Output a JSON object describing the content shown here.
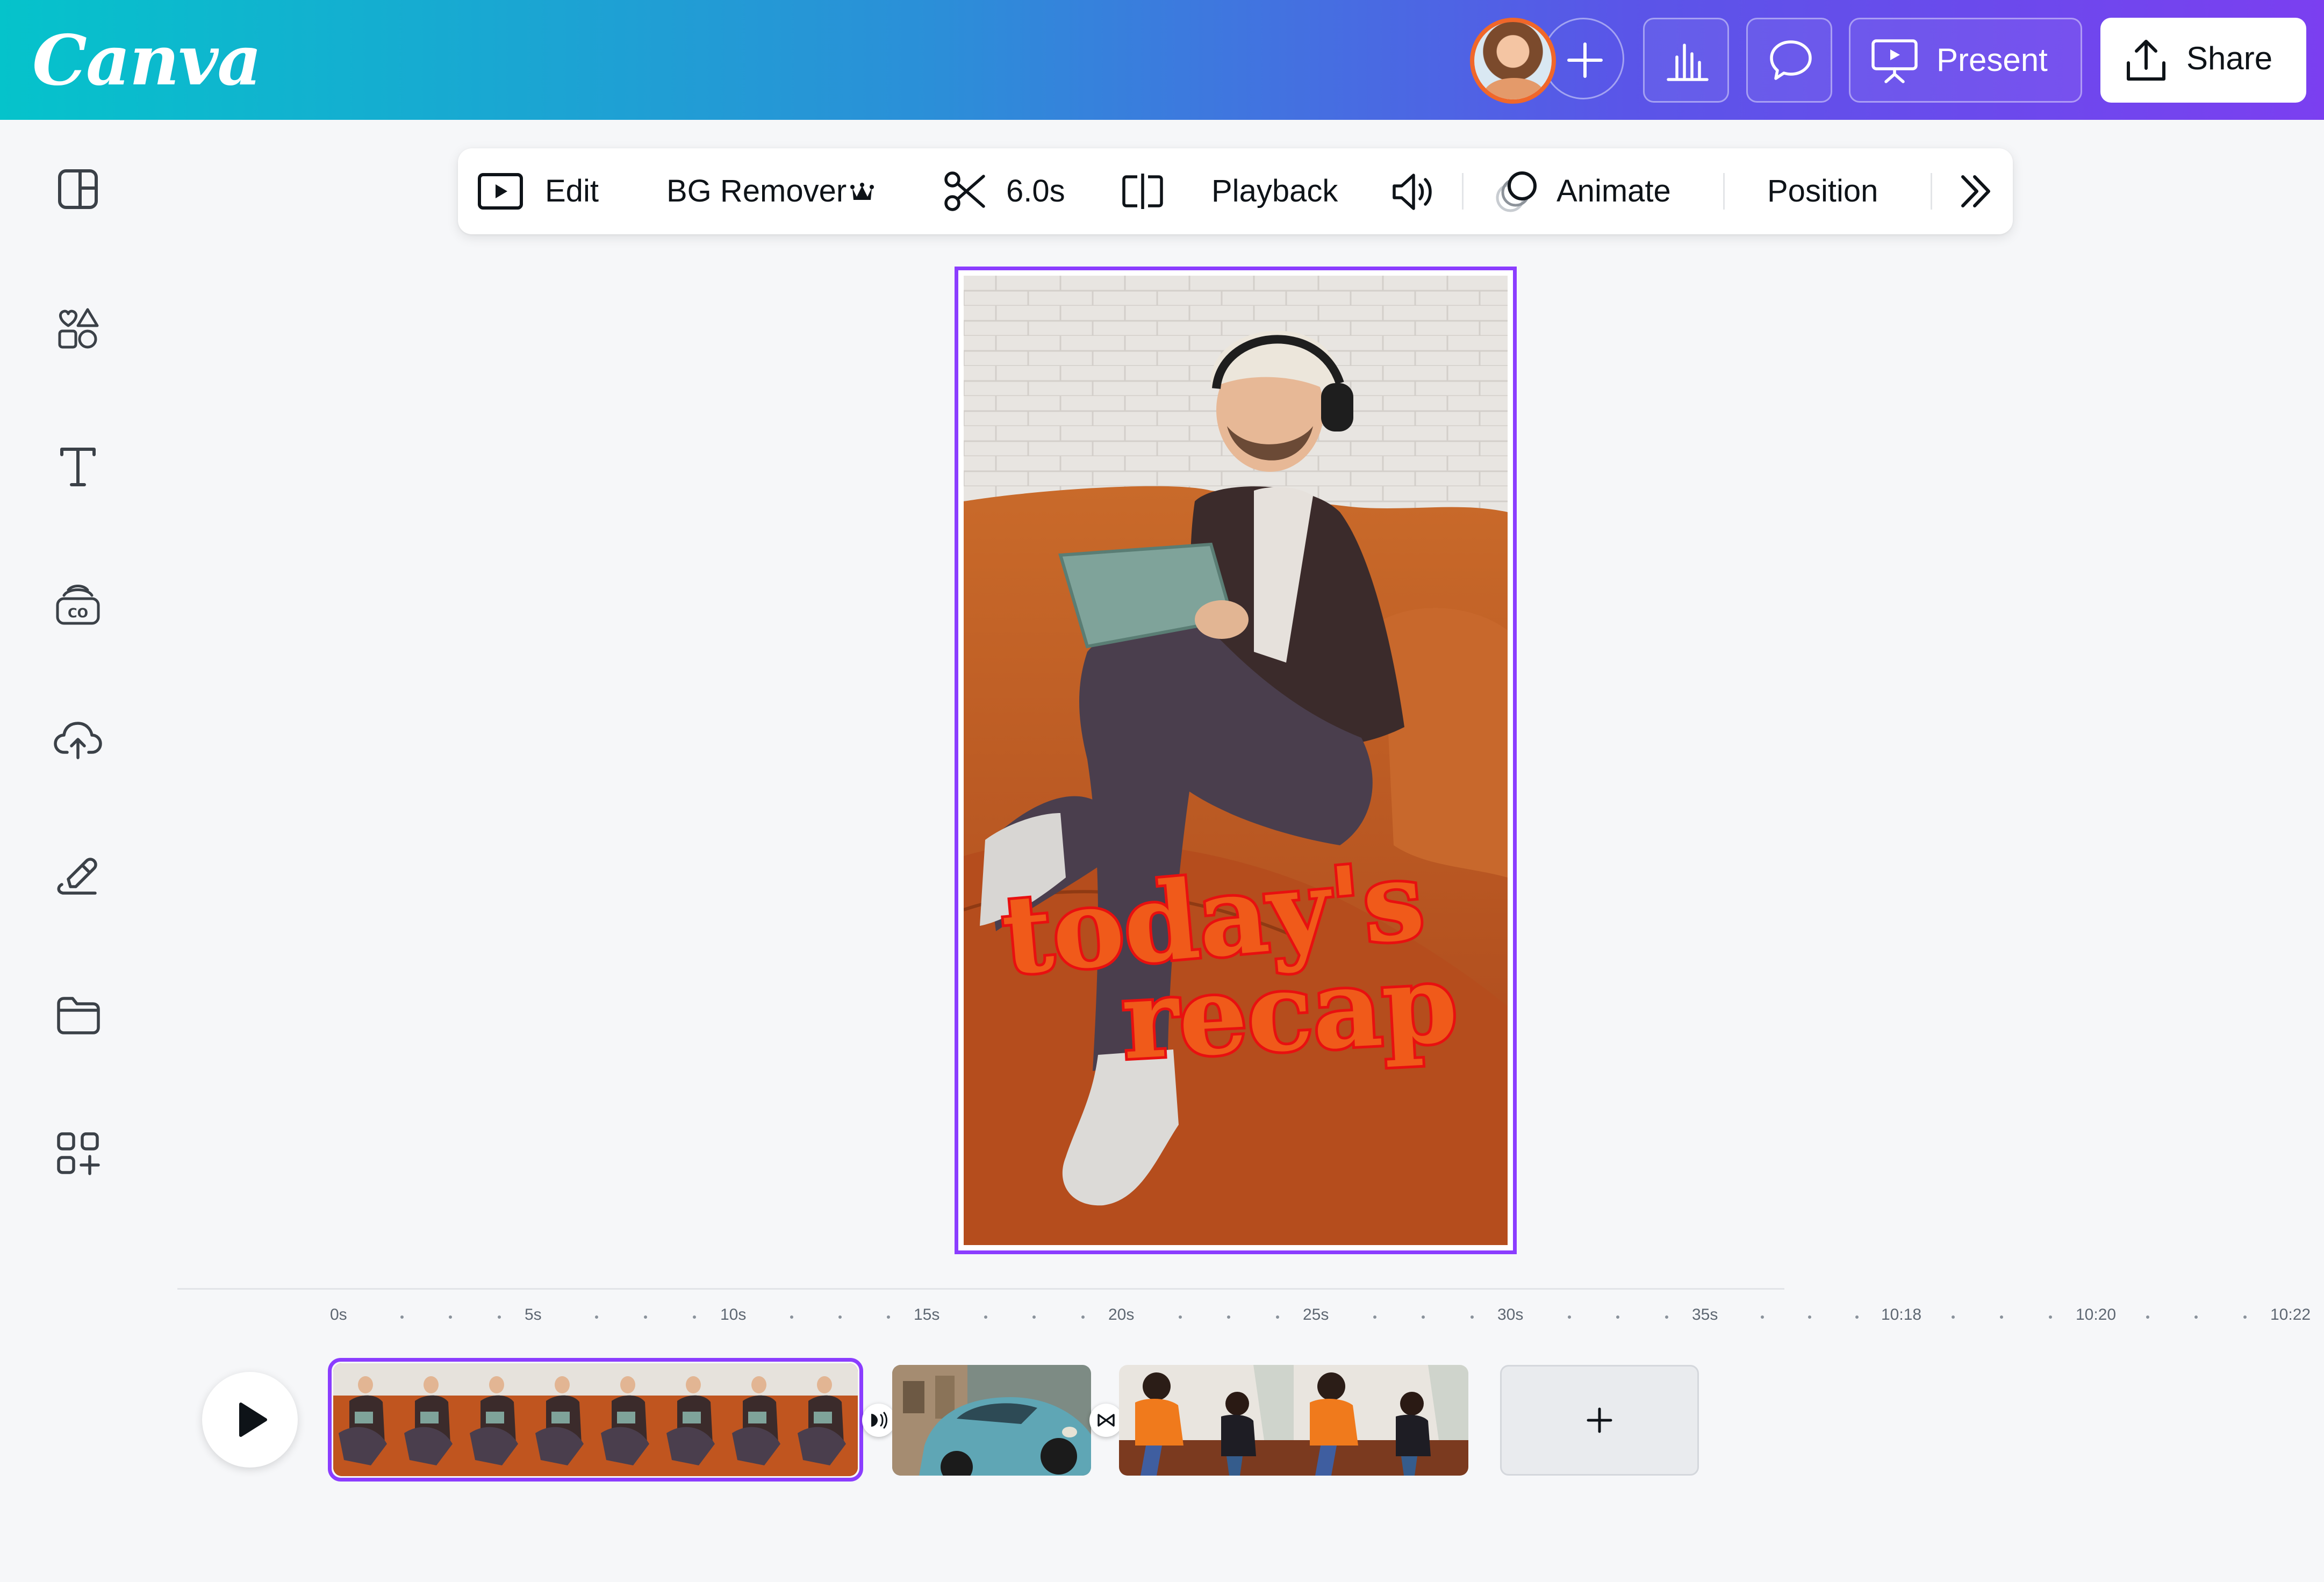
{
  "app": {
    "logo": "Canva"
  },
  "header": {
    "avatar_icon": "user-avatar",
    "add_collaborator_icon": "plus-icon",
    "insights_icon": "bar-chart-icon",
    "comments_icon": "speech-bubble-icon",
    "present_label": "Present",
    "present_icon": "present-screen-icon",
    "share_label": "Share",
    "share_icon": "upload-share-icon"
  },
  "sidebar": {
    "items": [
      {
        "icon": "design-layout-icon"
      },
      {
        "icon": "elements-shapes-icon"
      },
      {
        "icon": "text-icon"
      },
      {
        "icon": "brand-kit-icon"
      },
      {
        "icon": "cloud-upload-icon"
      },
      {
        "icon": "draw-pen-icon"
      },
      {
        "icon": "folder-icon"
      },
      {
        "icon": "apps-grid-plus-icon"
      }
    ]
  },
  "context_toolbar": {
    "edit_label": "Edit",
    "bg_remover_label": "BG Remover",
    "duration_label": "6.0s",
    "playback_label": "Playback",
    "animate_label": "Animate",
    "position_label": "Position",
    "icons": {
      "edit": "video-play-icon",
      "bg_remover_badge": "crown-icon",
      "trim": "scissors-icon",
      "split": "split-icon",
      "volume": "speaker-icon",
      "animate": "animate-circles-icon",
      "more": "double-chevron-right-icon"
    }
  },
  "canvas": {
    "caption_line1": "today's",
    "caption_line2": "recap"
  },
  "timeline": {
    "ruler": [
      {
        "label": "0s"
      },
      {
        "label": "5s"
      },
      {
        "label": "10s"
      },
      {
        "label": "15s"
      },
      {
        "label": "20s"
      },
      {
        "label": "25s"
      },
      {
        "label": "30s"
      },
      {
        "label": "35s"
      },
      {
        "label": "10:18"
      },
      {
        "label": "10:20"
      },
      {
        "label": "10:22"
      }
    ],
    "add_clip_icon": "plus-icon",
    "play_icon": "play-icon",
    "transition_icons": [
      "transition-icon",
      "bowtie-transition-icon"
    ]
  },
  "colors": {
    "accent_purple": "#8b3dff",
    "caption_fill": "#f05a1a",
    "caption_outline": "#e81010",
    "gradient_start": "#05c3cb",
    "gradient_end": "#7b3ff0"
  }
}
